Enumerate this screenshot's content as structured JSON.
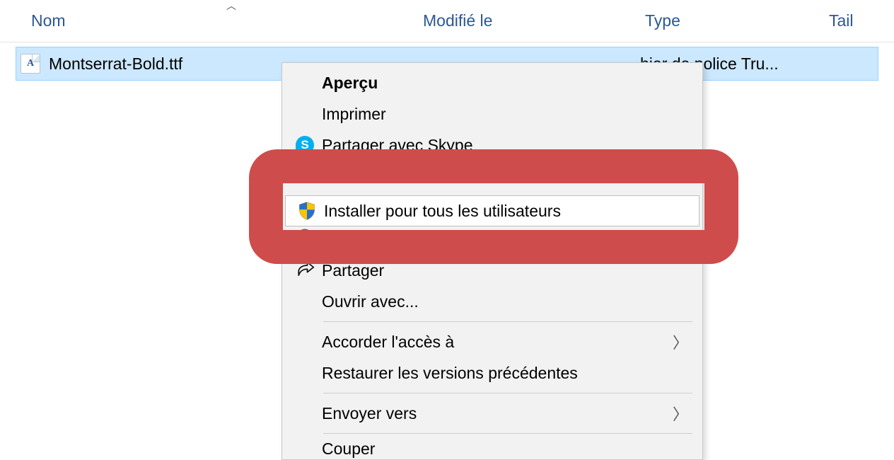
{
  "headers": {
    "name": "Nom",
    "modified": "Modifié le",
    "type": "Type",
    "size": "Tail"
  },
  "file": {
    "name": "Montserrat-Bold.ttf",
    "type_truncated": "hier de police Tru..."
  },
  "contextMenu": {
    "preview": "Aperçu",
    "print": "Imprimer",
    "shareSkype": "Partager avec Skype",
    "installAllUsers": "Installer pour tous les utilisateurs",
    "share": "Partager",
    "openWith": "Ouvrir avec...",
    "grantAccess": "Accorder l'accès à",
    "restorePrevious": "Restaurer les versions précédentes",
    "sendTo": "Envoyer vers",
    "cut": "Couper"
  }
}
